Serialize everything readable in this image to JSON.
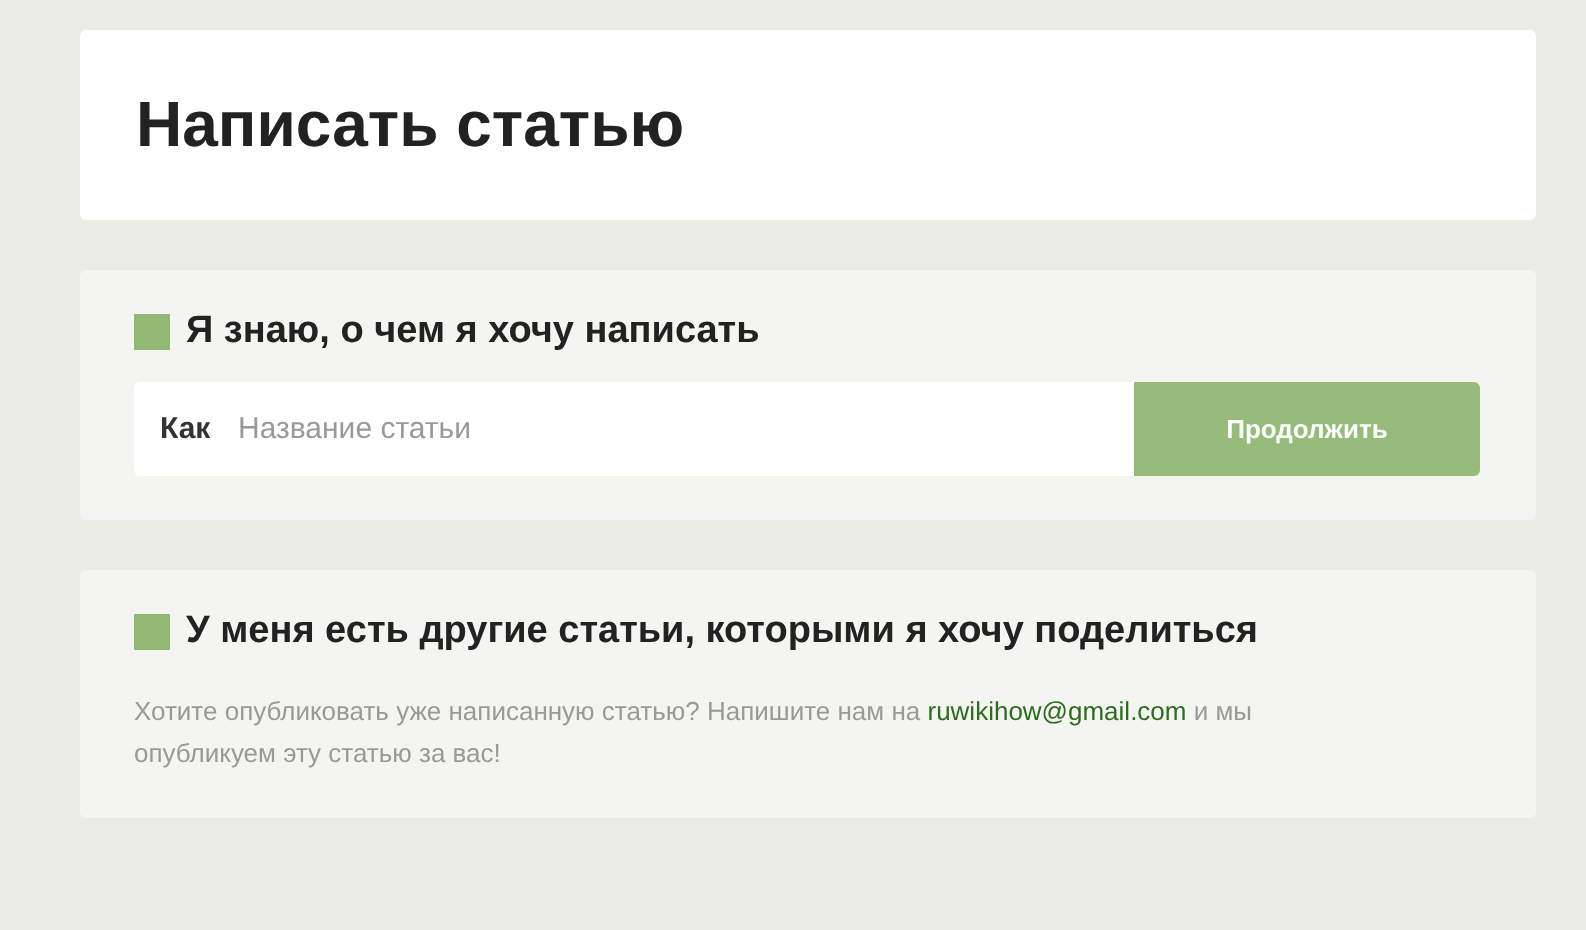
{
  "title": "Написать статью",
  "write_section": {
    "heading": "Я знаю, о чем я хочу написать",
    "prefix": "Как",
    "placeholder": "Название статьи",
    "button": "Продолжить"
  },
  "share_section": {
    "heading": "У меня есть другие статьи, которыми я хочу поделиться",
    "text_before": "Хотите опубликовать уже написанную статью? Напишите нам на",
    "link": "ruwikihow@gmail.com",
    "text_after": "и мы опубликуем эту статью за вас!"
  }
}
